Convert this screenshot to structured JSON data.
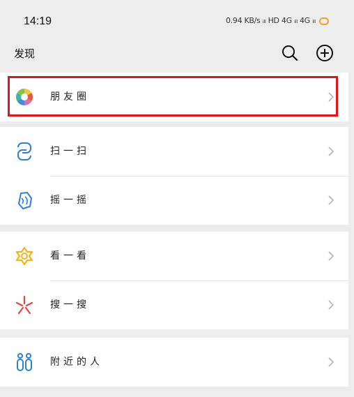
{
  "status_bar": {
    "time": "14:19",
    "indicators": "0.94 KB/s ᵢₗₗ HD 4G ᵢₗₗ 4G ᵢₗₗ"
  },
  "nav": {
    "title": "发现",
    "search_icon": "search-icon",
    "add_icon": "add-circle-icon"
  },
  "highlight_color": "#e0141c",
  "groups": [
    {
      "items": [
        {
          "label": "朋友圈",
          "icon": "moments-aperture-icon"
        }
      ]
    },
    {
      "items": [
        {
          "label": "扫一扫",
          "icon": "scan-icon"
        },
        {
          "label": "摇一摇",
          "icon": "shake-icon"
        }
      ]
    },
    {
      "items": [
        {
          "label": "看一看",
          "icon": "top-stories-icon"
        },
        {
          "label": "搜一搜",
          "icon": "search-star-icon"
        }
      ]
    },
    {
      "items": [
        {
          "label": "附近的人",
          "icon": "people-nearby-icon"
        }
      ]
    }
  ]
}
